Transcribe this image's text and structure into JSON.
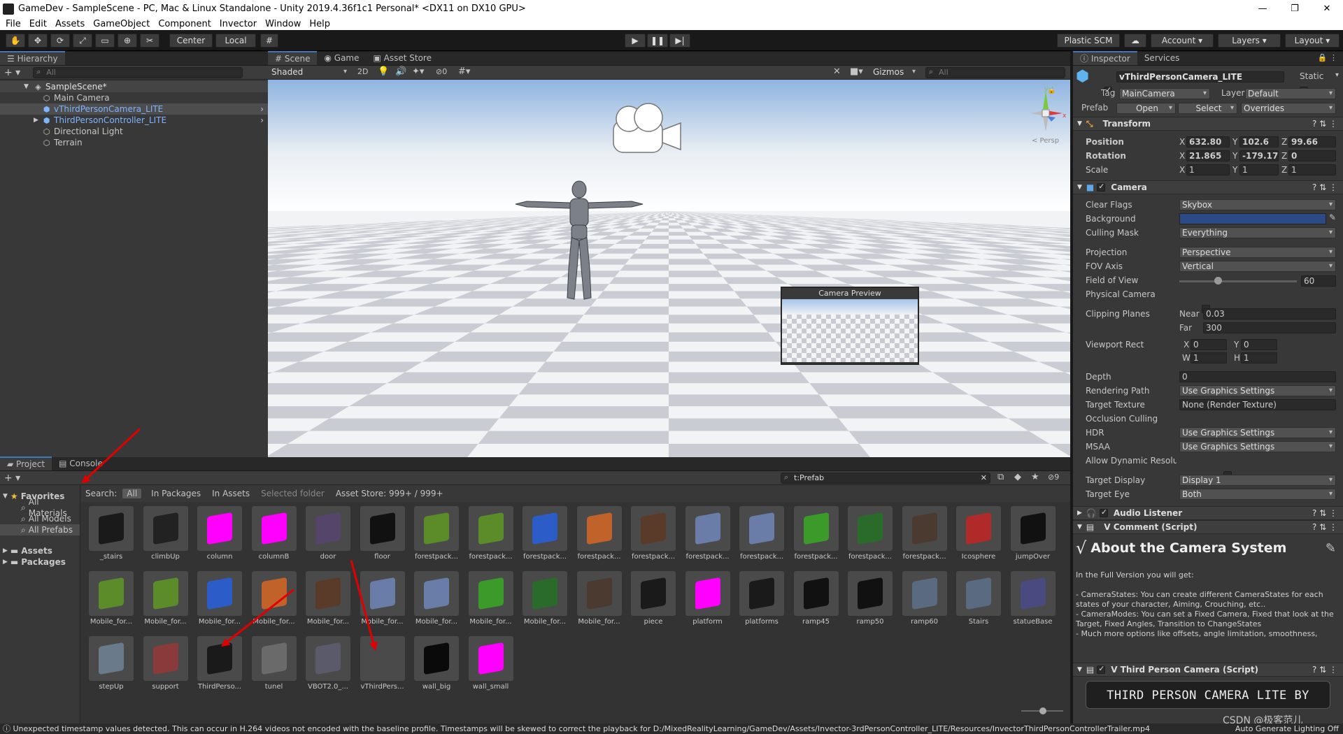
{
  "window": {
    "title": "GameDev - SampleScene - PC, Mac & Linux Standalone - Unity 2019.4.36f1c1 Personal* <DX11 on DX10 GPU>",
    "minimize": "—",
    "maximize": "❐",
    "close": "✕"
  },
  "menu": [
    "File",
    "Edit",
    "Assets",
    "GameObject",
    "Component",
    "Invector",
    "Window",
    "Help"
  ],
  "toolbar": {
    "center_label": "Center",
    "local_label": "Local",
    "plastic_label": "Plastic SCM",
    "account_label": "Account",
    "layers_label": "Layers",
    "layout_label": "Layout"
  },
  "hierarchy": {
    "tab": "Hierarchy",
    "search_placeholder": "All",
    "scene": "SampleScene*",
    "items": [
      {
        "label": "Main Camera"
      },
      {
        "label": "vThirdPersonCamera_LITE"
      },
      {
        "label": "ThirdPersonController_LITE"
      },
      {
        "label": "Directional Light"
      },
      {
        "label": "Terrain"
      }
    ]
  },
  "scene": {
    "tabs": [
      "Scene",
      "Game",
      "Asset Store"
    ],
    "shading": "Shaded",
    "mode2d": "2D",
    "hidden_count": "0",
    "gizmos": "Gizmos",
    "search_placeholder": "All",
    "persp_label": "< Persp",
    "camera_preview_title": "Camera Preview"
  },
  "inspector": {
    "tabs": [
      "Inspector",
      "Services"
    ],
    "object_name": "vThirdPersonCamera_LITE",
    "static_label": "Static",
    "tag_label": "Tag",
    "tag_value": "MainCamera",
    "layer_label": "Layer",
    "layer_value": "Default",
    "prefab_label": "Prefab",
    "open_label": "Open",
    "select_label": "Select",
    "overrides_label": "Overrides",
    "transform": {
      "title": "Transform",
      "position_label": "Position",
      "pos_x": "632.80",
      "pos_y": "102.6",
      "pos_z": "99.66",
      "rotation_label": "Rotation",
      "rot_x": "21.865",
      "rot_y": "-179.17",
      "rot_z": "0",
      "scale_label": "Scale",
      "sc_x": "1",
      "sc_y": "1",
      "sc_z": "1"
    },
    "camera": {
      "title": "Camera",
      "clear_flags_label": "Clear Flags",
      "clear_flags": "Skybox",
      "background_label": "Background",
      "background_color": "#2c4a86",
      "culling_label": "Culling Mask",
      "culling": "Everything",
      "projection_label": "Projection",
      "projection": "Perspective",
      "fov_axis_label": "FOV Axis",
      "fov_axis": "Vertical",
      "fov_label": "Field of View",
      "fov": "60",
      "fov_fraction": 0.33,
      "physical_label": "Physical Camera",
      "clipping_label": "Clipping Planes",
      "near_label": "Near",
      "near": "0.03",
      "far_label": "Far",
      "far": "300",
      "viewport_label": "Viewport Rect",
      "vx": "0",
      "vy": "0",
      "vw": "1",
      "vh": "1",
      "depth_label": "Depth",
      "depth": "0",
      "render_path_label": "Rendering Path",
      "render_path": "Use Graphics Settings",
      "target_tex_label": "Target Texture",
      "target_tex": "None (Render Texture)",
      "occlusion_label": "Occlusion Culling",
      "hdr_label": "HDR",
      "hdr": "Use Graphics Settings",
      "msaa_label": "MSAA",
      "msaa": "Use Graphics Settings",
      "dyn_res_label": "Allow Dynamic Resolution",
      "target_display_label": "Target Display",
      "target_display": "Display 1",
      "target_eye_label": "Target Eye",
      "target_eye": "Both"
    },
    "audio_listener": "Audio Listener",
    "comment": {
      "title": "V Comment (Script)",
      "heading": "About the Camera System",
      "body": [
        "In the Full Version you will get:",
        "",
        "- CameraStates: You can create different CameraStates for each states of your character, Aiming, Crouching, etc..",
        "- CameraModes: You can set a Fixed Camera, Fixed that look at the Target, Fixed Angles, Transition to ChangeStates",
        "- Much more options like offsets, angle limitation, smoothness,"
      ]
    },
    "tpc_script": "V Third Person Camera (Script)",
    "banner": "THIRD PERSON CAMERA LITE BY INVECTOR"
  },
  "project": {
    "tabs": [
      "Project",
      "Console"
    ],
    "search_value": "t:Prefab",
    "hidden_count": "9",
    "favorites_label": "Favorites",
    "favorites": [
      "All Materials",
      "All Models",
      "All Prefabs"
    ],
    "roots": [
      "Assets",
      "Packages"
    ],
    "search_label": "Search:",
    "scopes": [
      "All",
      "In Packages",
      "In Assets",
      "Selected folder",
      "Asset Store: 999+ / 999+"
    ],
    "assets": [
      {
        "name": "_stairs",
        "color": "#1a1a1a"
      },
      {
        "name": "climbUp",
        "color": "#222"
      },
      {
        "name": "column",
        "color": "#ff00ff"
      },
      {
        "name": "columnB",
        "color": "#ff00ff"
      },
      {
        "name": "door",
        "color": "#55456a"
      },
      {
        "name": "floor",
        "color": "#111"
      },
      {
        "name": "forestpack...",
        "color": "#5c8c2a"
      },
      {
        "name": "forestpack...",
        "color": "#5c8c2a"
      },
      {
        "name": "forestpack...",
        "color": "#2c5cc8"
      },
      {
        "name": "forestpack...",
        "color": "#c0622a"
      },
      {
        "name": "forestpack...",
        "color": "#5a3a28"
      },
      {
        "name": "forestpack...",
        "color": "#6a7ca8"
      },
      {
        "name": "forestpack...",
        "color": "#6a7ca8"
      },
      {
        "name": "forestpack...",
        "color": "#3c9a2a"
      },
      {
        "name": "forestpack...",
        "color": "#2a6a2a"
      },
      {
        "name": "forestpack...",
        "color": "#4a3a30"
      },
      {
        "name": "Icosphere",
        "color": "#b02a2a"
      },
      {
        "name": "jumpOver",
        "color": "#111"
      },
      {
        "name": "Mobile_for...",
        "color": "#5c8c2a"
      },
      {
        "name": "Mobile_for...",
        "color": "#5c8c2a"
      },
      {
        "name": "Mobile_for...",
        "color": "#2c5cc8"
      },
      {
        "name": "Mobile_for...",
        "color": "#c0622a"
      },
      {
        "name": "Mobile_for...",
        "color": "#5a3a28"
      },
      {
        "name": "Mobile_for...",
        "color": "#6a7ca8"
      },
      {
        "name": "Mobile_for...",
        "color": "#6a7ca8"
      },
      {
        "name": "Mobile_for...",
        "color": "#3c9a2a"
      },
      {
        "name": "Mobile_for...",
        "color": "#2a6a2a"
      },
      {
        "name": "Mobile_for...",
        "color": "#4a3a30"
      },
      {
        "name": "piece",
        "color": "#1a1a1a"
      },
      {
        "name": "platform",
        "color": "#ff00ff"
      },
      {
        "name": "platforms",
        "color": "#1a1a1a"
      },
      {
        "name": "ramp45",
        "color": "#111"
      },
      {
        "name": "ramp50",
        "color": "#111"
      },
      {
        "name": "ramp60",
        "color": "#5a6a80"
      },
      {
        "name": "Stairs",
        "color": "#5a6a80"
      },
      {
        "name": "statueBase",
        "color": "#4a4a80"
      },
      {
        "name": "stepUp",
        "color": "#6a7a8a"
      },
      {
        "name": "support",
        "color": "#8a3a3a"
      },
      {
        "name": "ThirdPerso...",
        "color": "#1a1a1a"
      },
      {
        "name": "tunel",
        "color": "#6a6a6a"
      },
      {
        "name": "VBOT2.0_...",
        "color": "#5a5a6a"
      },
      {
        "name": "vThirdPers...",
        "color": "#4a4a4a"
      },
      {
        "name": "wall_big",
        "color": "#0a0a0a"
      },
      {
        "name": "wall_small",
        "color": "#ff00ff"
      }
    ]
  },
  "statusbar": {
    "message": "Unexpected timestamp values detected. This can occur in H.264 videos not encoded with the baseline profile. Timestamps will be skewed to correct the playback for D:/MixedRealityLearning/GameDev/Assets/Invector-3rdPersonController_LITE/Resources/InvectorThirdPersonControllerTrailer.mp4",
    "right": "Auto Generate Lighting Off",
    "watermark": "CSDN @极客范儿"
  }
}
